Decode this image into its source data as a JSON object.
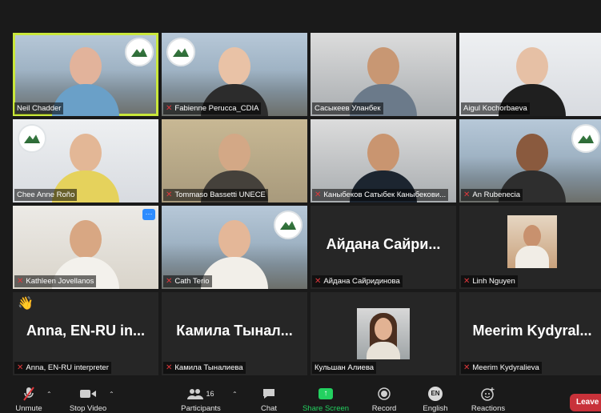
{
  "participants": [
    {
      "name": "Neil Chadder",
      "muted": false
    },
    {
      "name": "Fabienne Perucca_CDIA",
      "muted": true
    },
    {
      "name": "Сасыкеев Уланбек",
      "muted": false
    },
    {
      "name": "Aigul Kochorbaeva",
      "muted": false
    },
    {
      "name": "Chee Anne Roño",
      "muted": false
    },
    {
      "name": "Tommaso Bassetti UNECE",
      "muted": true
    },
    {
      "name": "Каныбеков Сатыбек Каныбекови...",
      "muted": true
    },
    {
      "name": "An Rubenecia",
      "muted": true
    },
    {
      "name": "Kathleen Jovellanos",
      "muted": true
    },
    {
      "name": "Cath Terio",
      "muted": true
    },
    {
      "name": "Айдана Сайридинова",
      "muted": true,
      "display_name": "Айдана Сайри..."
    },
    {
      "name": "Linh Nguyen",
      "muted": true
    },
    {
      "name": "Anna, EN-RU interpreter",
      "muted": true,
      "display_name": "Anna, EN-RU in..."
    },
    {
      "name": "Камила Тыналиева",
      "muted": true,
      "display_name": "Камила Тынал..."
    },
    {
      "name": "Кульшан Алиева",
      "muted": false
    },
    {
      "name": "Meerim Kydyralieva",
      "muted": true,
      "display_name": "Meerim Kydyral..."
    }
  ],
  "tile_menu_label": "···",
  "reaction_emoji": "👋",
  "toolbar": {
    "unmute": "Unmute",
    "stop_video": "Stop Video",
    "participants": "Participants",
    "participants_count": "16",
    "chat": "Chat",
    "share_screen": "Share Screen",
    "record": "Record",
    "english": "English",
    "english_badge": "EN",
    "reactions": "Reactions",
    "leave": "Leave"
  },
  "colors": {
    "active_speaker": "#c9e73b",
    "share_green": "#23d160",
    "leave_red": "#c8323a",
    "muted_red": "#e0373b"
  }
}
